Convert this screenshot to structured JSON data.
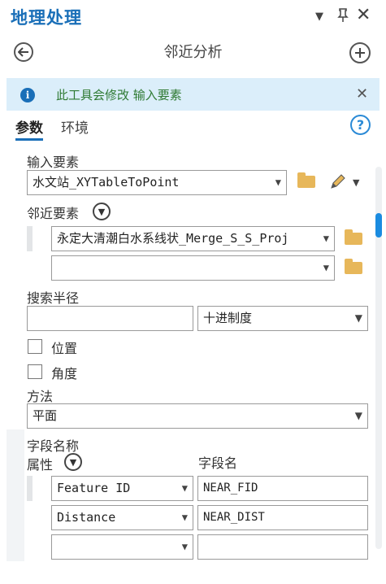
{
  "pane": {
    "title": "地理处理"
  },
  "tool": {
    "title": "邻近分析"
  },
  "info": {
    "message": "此工具会修改 输入要素"
  },
  "tabs": [
    "参数",
    "环境"
  ],
  "params": {
    "input_features": {
      "label": "输入要素",
      "value": "水文站_XYTableToPoint"
    },
    "near_features": {
      "label": "邻近要素",
      "values": [
        "永定大清潮白水系线状_Merge_S_S_Proj",
        ""
      ]
    },
    "search_radius": {
      "label": "搜索半径",
      "value": "",
      "unit": "十进制度"
    },
    "location": {
      "label": "位置",
      "checked": false
    },
    "angle": {
      "label": "角度",
      "checked": false
    },
    "method": {
      "label": "方法",
      "value": "平面"
    },
    "field_names": {
      "label": "字段名称",
      "col_attr": "属性",
      "col_field": "字段名",
      "rows": [
        {
          "attr": "Feature ID",
          "field": "NEAR_FID"
        },
        {
          "attr": "Distance",
          "field": "NEAR_DIST"
        },
        {
          "attr": "",
          "field": ""
        }
      ]
    }
  },
  "colors": {
    "accent": "#1a6fb8",
    "info_bg": "#dbeefa",
    "info_text": "#2f7a33",
    "folder": "#e7b75a"
  }
}
